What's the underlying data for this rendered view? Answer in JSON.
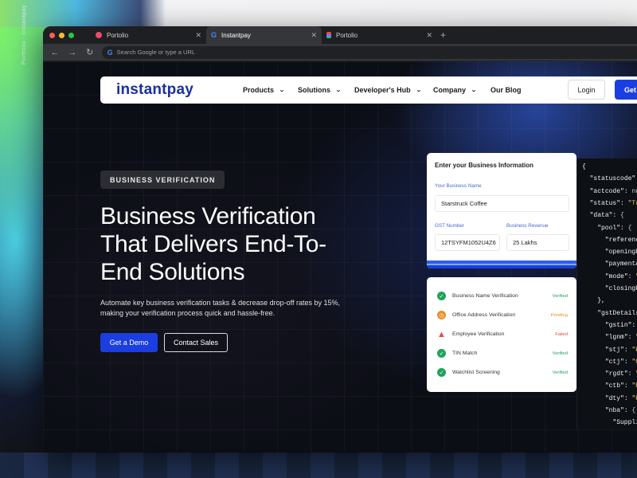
{
  "side_text": "Portfolio - Instantpay",
  "browser": {
    "tabs": [
      {
        "title": "Portolio",
        "active": false,
        "favicon_color": "#e84c6c"
      },
      {
        "title": "Instantpay",
        "active": true,
        "favicon_color": "#4285f4"
      },
      {
        "title": "Portolio",
        "active": false,
        "favicon_color": "#f24e1e"
      }
    ],
    "address_placeholder": "Search Google or type a URL"
  },
  "nav": {
    "logo": "instantpay",
    "items": [
      "Products",
      "Solutions",
      "Developer's Hub",
      "Company",
      "Our Blog"
    ],
    "login": "Login",
    "get_started": "Get"
  },
  "hero": {
    "badge": "BUSINESS VERIFICATION",
    "title_lines": [
      "Business Verification",
      "That Delivers End-To-",
      "End Solutions"
    ],
    "desc_lines": [
      "Automate key business verification tasks & decrease drop-off rates by 15%,",
      "making your verification process quick and hassle-free."
    ],
    "demo_button": "Get a Demo",
    "contact_button": "Contact Sales"
  },
  "form": {
    "title": "Enter your Business Information",
    "name_label": "Your Business Name",
    "name_value": "Starstruck Coffee",
    "gst_label": "GST Number",
    "gst_value": "12TSYFM1052U4Z6",
    "revenue_label": "Business Revenue",
    "revenue_value": "25 Lakhs"
  },
  "checks": [
    {
      "label": "Business Name Verification",
      "status": "Verified",
      "state": "ok"
    },
    {
      "label": "Office Address Verification",
      "status": "Pending",
      "state": "pending"
    },
    {
      "label": "Employee Verification",
      "status": "Failed",
      "state": "failed"
    },
    {
      "label": "TIN Match",
      "status": "Verified",
      "state": "ok"
    },
    {
      "label": "Watchlist Screening",
      "status": "Verified",
      "state": "ok"
    }
  ],
  "colors": {
    "ok": "#22a35a",
    "pending": "#e8912b",
    "failed": "#e0493a",
    "brand": "#1a3ee0"
  },
  "code_lines": [
    "{",
    "  \"statuscode\": \"T",
    "  \"actcode\": null,",
    "  \"status\": \"Transa",
    "  \"data\": {",
    "    \"pool\": {",
    "      \"referencelo",
    "      \"openingBala",
    "      \"paymentAm",
    "      \"mode\": \"DR",
    "      \"closingBala",
    "    },",
    "    \"gstDetails\": {",
    "      \"gstin\": \"24",
    "      \"lgnm\": \"Sta",
    "      \"stj\": \"Harya",
    "      \"ctj\": \"Guru",
    "      \"rgdt\": \"05/",
    "      \"ctb\": \"Prop",
    "      \"dty\": \"Regu",
    "      \"nba\": {",
    "        \"Supplier"
  ]
}
